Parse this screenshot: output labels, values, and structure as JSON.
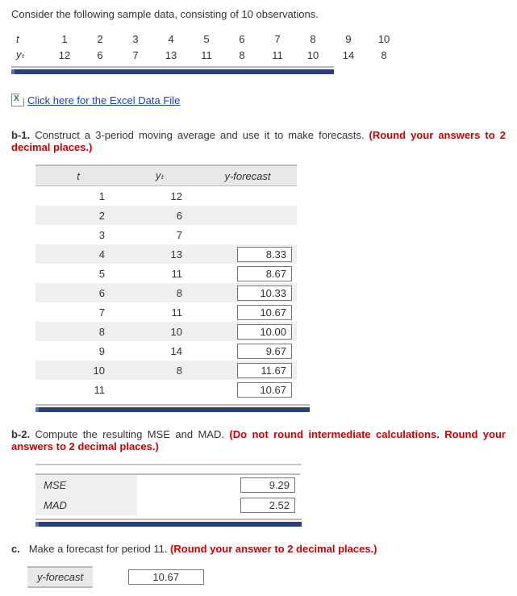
{
  "prompt": "Consider the following sample data, consisting of 10 observations.",
  "data_table": {
    "row_labels": [
      "t",
      "yₜ"
    ],
    "t": [
      "1",
      "2",
      "3",
      "4",
      "5",
      "6",
      "7",
      "8",
      "9",
      "10"
    ],
    "yt": [
      "12",
      "6",
      "7",
      "13",
      "11",
      "8",
      "11",
      "10",
      "14",
      "8"
    ]
  },
  "file_link": "Click here for the Excel Data File",
  "b1": {
    "label": "b-1.",
    "text": "Construct a 3-period moving average and use it to make forecasts. ",
    "instr": "(Round your answers to 2 decimal places.)",
    "headers": {
      "t": "t",
      "yt": "yₜ",
      "yf": "y-forecast"
    },
    "rows": [
      {
        "t": "1",
        "yt": "12",
        "yf": ""
      },
      {
        "t": "2",
        "yt": "6",
        "yf": ""
      },
      {
        "t": "3",
        "yt": "7",
        "yf": ""
      },
      {
        "t": "4",
        "yt": "13",
        "yf": "8.33"
      },
      {
        "t": "5",
        "yt": "11",
        "yf": "8.67"
      },
      {
        "t": "6",
        "yt": "8",
        "yf": "10.33"
      },
      {
        "t": "7",
        "yt": "11",
        "yf": "10.67"
      },
      {
        "t": "8",
        "yt": "10",
        "yf": "10.00"
      },
      {
        "t": "9",
        "yt": "14",
        "yf": "9.67"
      },
      {
        "t": "10",
        "yt": "8",
        "yf": "11.67"
      },
      {
        "t": "11",
        "yt": "",
        "yf": "10.67"
      }
    ]
  },
  "b2": {
    "label": "b-2.",
    "text": "Compute the resulting MSE and MAD. ",
    "instr": "(Do not round intermediate calculations. Round your answers to 2 decimal places.)",
    "rows": [
      {
        "label": "MSE",
        "value": "9.29"
      },
      {
        "label": "MAD",
        "value": "2.52"
      }
    ]
  },
  "c": {
    "label": "c.",
    "text": "Make a forecast for period 11. ",
    "instr": "(Round your answer to 2 decimal places.)",
    "yf_label": "y-forecast",
    "yf_value": "10.67"
  }
}
